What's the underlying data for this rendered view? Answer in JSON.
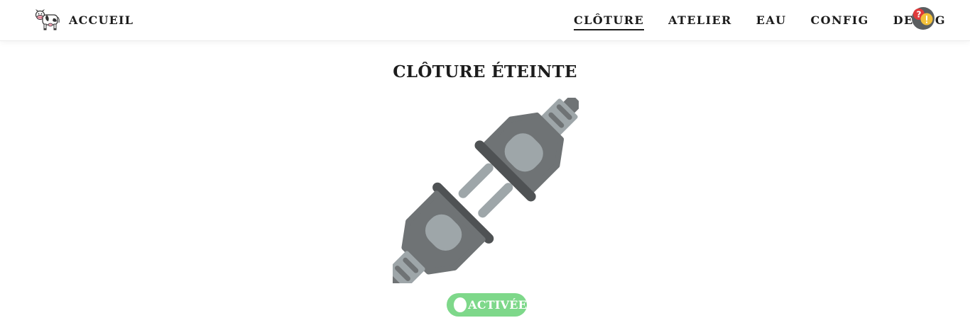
{
  "nav": {
    "brand_label": "ACCUEIL",
    "brand_icon": "cow-icon",
    "items": [
      {
        "label": "CLÔTURE",
        "active": true
      },
      {
        "label": "ATELIER",
        "active": false
      },
      {
        "label": "EAU",
        "active": false
      },
      {
        "label": "CONFIG",
        "active": false
      },
      {
        "label": "DEBUG",
        "active": false
      }
    ],
    "status_icon": "status-question-warning-icon"
  },
  "main": {
    "title": "CLÔTURE ÉTEINTE",
    "illustration": "unplugged-connector-icon",
    "toggle": {
      "label": "ACTIVÉE",
      "state": "on",
      "color": "#7ed88a"
    }
  },
  "colors": {
    "accent_green": "#7ed88a",
    "plug_dark": "#4f5254",
    "plug_mid": "#6f7375",
    "plug_light": "#9ea6a9",
    "avatar_red": "#e03a3a",
    "avatar_yellow": "#f2c038"
  }
}
